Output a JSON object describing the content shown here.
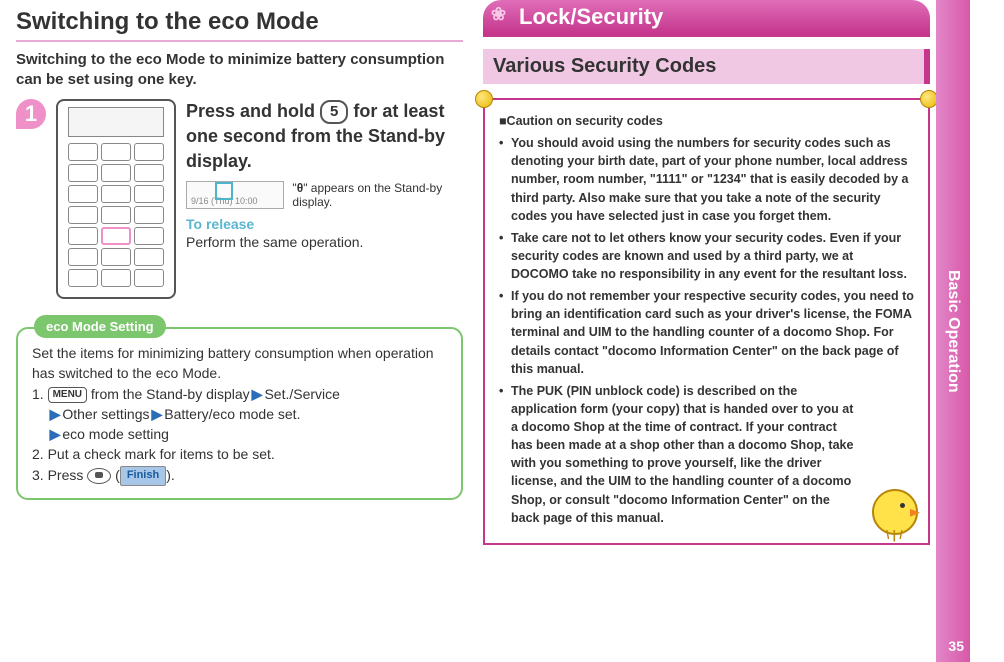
{
  "side_tab": "Basic Operation",
  "page_number": "35",
  "left": {
    "h1": "Switching to the eco Mode",
    "lead": "Switching to the eco Mode to minimize battery consumption can be set using one key.",
    "step_number": "1",
    "step_a": "Press and hold ",
    "step_key": "5",
    "step_b": " for at least one second from the Stand-by display.",
    "standby_mini_text": "9/16 (Thu) 10:00",
    "status_quote_a": "\"",
    "status_glyph": "θ",
    "status_quote_b": "\" appears on the Stand-by display.",
    "release_h": "To release",
    "release_body": "Perform the same operation.",
    "pill_label": "eco Mode Setting",
    "pill_intro": "Set the items for minimizing battery consumption when operation has switched to the eco Mode.",
    "pill_s1_a": "1. ",
    "pill_menu_key": "MENU",
    "pill_s1_b": " from the Stand-by display",
    "pill_s1_c": "Set./Service",
    "pill_s1_d": "Other settings",
    "pill_s1_e": "Battery/eco mode set.",
    "pill_s1_f": "eco mode setting",
    "pill_s2": "2. Put a check mark for items to be set.",
    "pill_s3_a": "3. Press ",
    "pill_s3_b": "(",
    "pill_finish": "Finish",
    "pill_s3_c": ")."
  },
  "right": {
    "ribbon": "Lock/Security",
    "subhead": "Various Security Codes",
    "caution_head": "■Caution on security codes",
    "bullets": [
      "You should avoid using the numbers for security codes such as denoting your birth date, part of your phone number, local address number, room number, \"1111\" or \"1234\" that is easily decoded by a third party. Also make sure that you take a note of the security codes you have selected just in case you forget them.",
      "Take care not to let others know your security codes. Even if your security codes are known and used by a third party, we at DOCOMO take no responsibility in any event for the resultant loss.",
      "If you do not remember your respective security codes, you need to bring an identification card such as your driver's license, the FOMA terminal and UIM to the handling counter of a docomo Shop. For details contact \"docomo Information Center\" on the back page of this manual.",
      "The PUK (PIN unblock code) is described on the application form (your copy) that is handed over to you at a docomo Shop at the time of contract. If your contract has been made at a shop other than a docomo Shop, take with you something to prove yourself, like the driver license, and the UIM to the handling counter of a docomo Shop, or consult \"docomo Information Center\" on the back page of this manual."
    ]
  }
}
